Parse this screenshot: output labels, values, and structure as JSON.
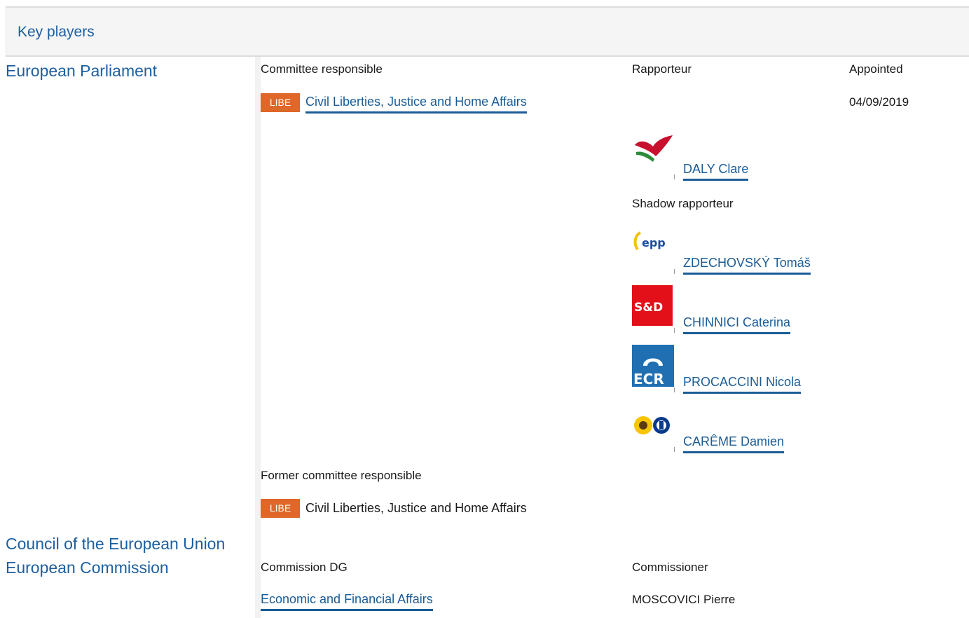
{
  "header": {
    "title": "Key players"
  },
  "institutions": {
    "ep": "European Parliament",
    "council": "Council of the European Union",
    "commission": "European Commission"
  },
  "ep": {
    "committee_heading": "Committee responsible",
    "rapporteur_heading": "Rapporteur",
    "appointed_heading": "Appointed",
    "committee_badge": "LIBE",
    "committee_name": "Civil Liberties, Justice and Home Affairs",
    "appointed_date": "04/09/2019",
    "rapporteur": {
      "name": "DALY Clare",
      "logo": "gue-ngl-logo"
    },
    "shadow_heading": "Shadow rapporteur",
    "shadows": [
      {
        "name": "ZDECHOVSKÝ Tomáš",
        "logo": "epp-logo",
        "logo_text": "epp"
      },
      {
        "name": "CHINNICI Caterina",
        "logo": "s-and-d-logo",
        "logo_text": "S&D"
      },
      {
        "name": "PROCACCINI Nicola",
        "logo": "ecr-logo",
        "logo_text": "ECR"
      },
      {
        "name": "CARÊME Damien",
        "logo": "greens-efa-logo"
      }
    ],
    "former_heading": "Former committee responsible",
    "former_badge": "LIBE",
    "former_name": "Civil Liberties, Justice and Home Affairs"
  },
  "commission": {
    "dg_heading": "Commission DG",
    "commissioner_heading": "Commissioner",
    "dg_name": "Economic and Financial Affairs",
    "commissioner_name": "MOSCOVICI Pierre"
  },
  "colors": {
    "link": "#1a5c96",
    "heading": "#1d5fa0",
    "badge": "#e0662a"
  }
}
